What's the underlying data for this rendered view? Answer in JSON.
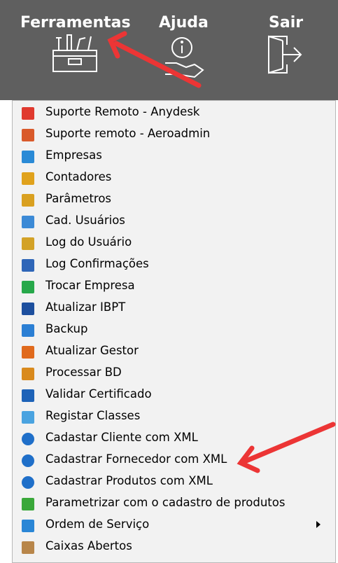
{
  "toolbar": {
    "ferramentas_label": "Ferramentas",
    "ajuda_label": "Ajuda",
    "sair_label": "Sair"
  },
  "menu": {
    "items": [
      {
        "label": "Suporte Remoto - Anydesk",
        "icon": "anydesk-icon",
        "color": "#e03a2f"
      },
      {
        "label": "Suporte remoto - Aeroadmin",
        "icon": "aeroadmin-icon",
        "color": "#d95a2b"
      },
      {
        "label": "Empresas",
        "icon": "building-icon",
        "color": "#2a8ad6"
      },
      {
        "label": "Contadores",
        "icon": "abacus-icon",
        "color": "#e0a21c"
      },
      {
        "label": "Parâmetros",
        "icon": "gears-icon",
        "color": "#d9a020"
      },
      {
        "label": "Cad. Usuários",
        "icon": "users-icon",
        "color": "#3c8ad6"
      },
      {
        "label": "Log do Usuário",
        "icon": "user-log-icon",
        "color": "#d3a227"
      },
      {
        "label": "Log Confirmações",
        "icon": "confirm-log-icon",
        "color": "#2f66b8"
      },
      {
        "label": "Trocar Empresa",
        "icon": "switch-company-icon",
        "color": "#27a84a"
      },
      {
        "label": "Atualizar IBPT",
        "icon": "ibpt-icon",
        "color": "#1d4f9e"
      },
      {
        "label": "Backup",
        "icon": "lock-icon",
        "color": "#2b7fd4"
      },
      {
        "label": "Atualizar Gestor",
        "icon": "update-gestor-icon",
        "color": "#e06a1d"
      },
      {
        "label": "Processar BD",
        "icon": "process-db-icon",
        "color": "#d98a1d"
      },
      {
        "label": "Validar Certificado",
        "icon": "certificate-icon",
        "color": "#1e63b8"
      },
      {
        "label": "Registar Classes",
        "icon": "register-icon",
        "color": "#4aa3e0"
      },
      {
        "label": "Cadastar Cliente com XML",
        "icon": "xml-client-icon",
        "color": "#1f6fc9"
      },
      {
        "label": "Cadastrar Fornecedor com XML",
        "icon": "xml-supplier-icon",
        "color": "#1f6fc9"
      },
      {
        "label": "Cadastrar Produtos com XML",
        "icon": "xml-products-icon",
        "color": "#1f6fc9"
      },
      {
        "label": "Parametrizar com o cadastro de produtos",
        "icon": "parametrize-icon",
        "color": "#3aa83a"
      },
      {
        "label": "Ordem de Serviço",
        "icon": "service-order-icon",
        "color": "#2a86d6"
      },
      {
        "label": "Caixas Abertos",
        "icon": "open-box-icon",
        "color": "#b8864a"
      }
    ]
  },
  "colors": {
    "topbar": "#5f5f5f",
    "menu_bg": "#f2f2f2",
    "annotation_arrow": "#ec3535"
  }
}
